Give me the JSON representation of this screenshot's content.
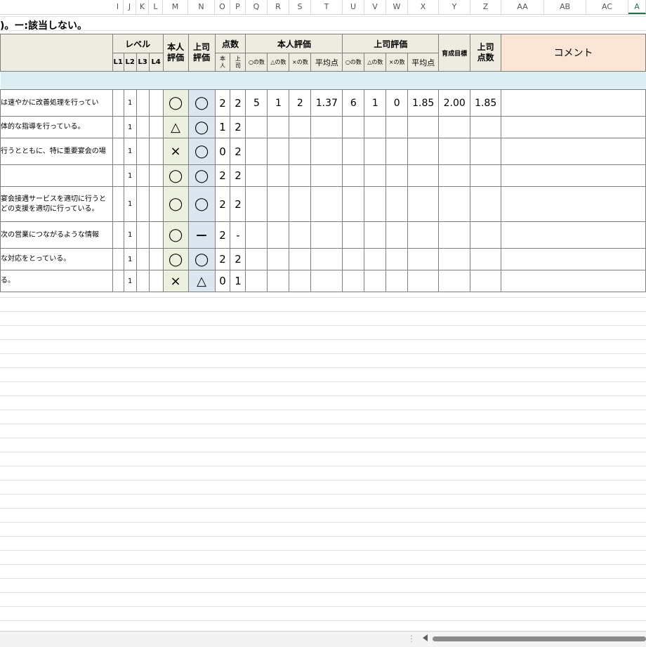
{
  "column_headers": [
    "I",
    "J",
    "K",
    "L",
    "M",
    "N",
    "O",
    "P",
    "Q",
    "R",
    "S",
    "T",
    "U",
    "V",
    "W",
    "X",
    "Y",
    "Z",
    "AA",
    "AB",
    "AC",
    "A"
  ],
  "note_text": ")。ー:該当しない。",
  "header": {
    "level": "レベル",
    "levels": [
      "L1",
      "L2",
      "L3",
      "L4"
    ],
    "self_eval": "本人\n評価",
    "boss_eval": "上司\n評価",
    "score": "点数",
    "score_self": "本\n人",
    "score_boss": "上\n司",
    "self_group": "本人評価",
    "boss_group": "上司評価",
    "count_circle": "○の数",
    "count_triangle": "△の数",
    "count_cross": "×の数",
    "average": "平均点",
    "target": "育成目標",
    "boss_points": "上司\n点数",
    "comment": "コメント"
  },
  "rows": [
    {
      "text": "は速やかに改善処理を行ってい",
      "level": "1",
      "self": "◯",
      "boss": "◯",
      "s_self": "2",
      "s_boss": "2"
    },
    {
      "text": "体的な指導を行っている。",
      "level": "1",
      "self": "△",
      "boss": "◯",
      "s_self": "1",
      "s_boss": "2"
    },
    {
      "text": "行うとともに、特に重要宴会の場",
      "level": "1",
      "self": "×",
      "boss": "◯",
      "s_self": "0",
      "s_boss": "2"
    },
    {
      "text": "",
      "level": "1",
      "self": "◯",
      "boss": "◯",
      "s_self": "2",
      "s_boss": "2"
    },
    {
      "text": "宴会接遇サービスを適切に行うと\nどの支援を適切に行っている。",
      "level": "1",
      "self": "◯",
      "boss": "◯",
      "s_self": "2",
      "s_boss": "2"
    },
    {
      "text": "次の営業につながるような情報",
      "level": "1",
      "self": "◯",
      "boss": "－",
      "s_self": "2",
      "s_boss": "-"
    },
    {
      "text": "な対応をとっている。",
      "level": "1",
      "self": "◯",
      "boss": "◯",
      "s_self": "2",
      "s_boss": "2"
    },
    {
      "text": "る。",
      "level": "1",
      "self": "×",
      "boss": "△",
      "s_self": "0",
      "s_boss": "1"
    }
  ],
  "summary": {
    "self_circle": "5",
    "self_triangle": "1",
    "self_cross": "2",
    "self_avg": "1.37",
    "boss_circle": "6",
    "boss_triangle": "1",
    "boss_cross": "0",
    "boss_avg": "1.85",
    "target": "2.00",
    "boss_points": "1.85"
  }
}
